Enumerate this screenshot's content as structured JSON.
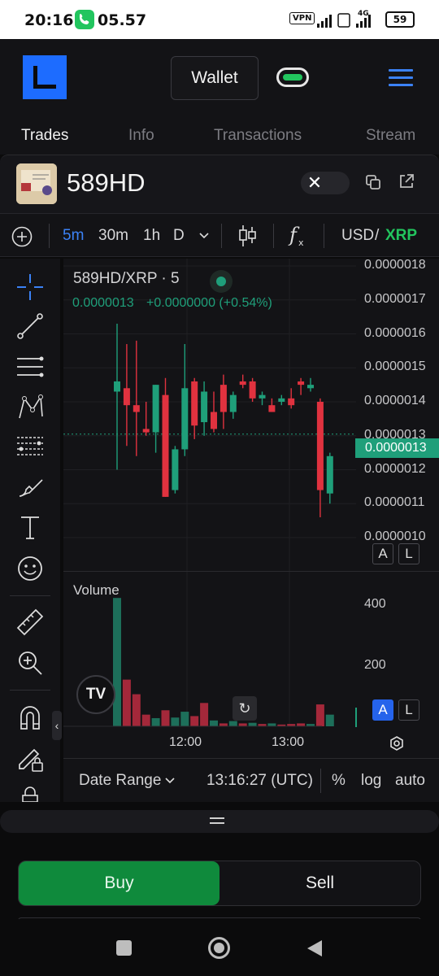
{
  "status_bar": {
    "time": "20:16",
    "call_time": "05.57",
    "vpn": "VPN",
    "network": "4G",
    "battery": "59"
  },
  "header": {
    "wallet_label": "Wallet"
  },
  "tabs": [
    {
      "label": "Trades",
      "active": true
    },
    {
      "label": "Info",
      "active": false
    },
    {
      "label": "Transactions",
      "active": false
    },
    {
      "label": "Stream",
      "active": false
    }
  ],
  "token": {
    "name": "589HD"
  },
  "toolbar": {
    "intervals": [
      "5m",
      "30m",
      "1h",
      "D"
    ],
    "selected_interval": "5m",
    "quote_usd": "USD",
    "quote_sep": "/",
    "quote_xrp": "XRP"
  },
  "chart": {
    "symbol": "589HD/XRP · 5",
    "last_price": "0.0000013",
    "change": "+0.0000000 (+0.54%)",
    "price_tag": "0.0000013",
    "price_ticks": [
      "0.0000018",
      "0.0000017",
      "0.0000016",
      "0.0000015",
      "0.0000014",
      "0.0000013",
      "0.0000012",
      "0.0000011",
      "0.0000010"
    ],
    "volume_label": "Volume",
    "volume_ticks": [
      "400",
      "200"
    ],
    "time_ticks": [
      "12:00",
      "13:00"
    ],
    "btn_a": "A",
    "btn_l": "L",
    "colors": {
      "up": "#1f9f7a",
      "down": "#e0323f",
      "accent": "#22c55e",
      "blue": "#3b82f6"
    }
  },
  "date_bar": {
    "date_range": "Date Range",
    "utc_time": "13:16:27 (UTC)",
    "percent": "%",
    "log": "log",
    "auto": "auto"
  },
  "trade": {
    "buy_label": "Buy",
    "sell_label": "Sell"
  },
  "chart_data": {
    "type": "candlestick",
    "ylim": [
      1e-06,
      1.8e-06
    ],
    "candles": [
      {
        "o": 1.43e-06,
        "h": 1.63e-06,
        "l": 1.2e-06,
        "c": 1.46e-06,
        "up": true
      },
      {
        "o": 1.44e-06,
        "h": 1.57e-06,
        "l": 1.27e-06,
        "c": 1.39e-06,
        "up": false
      },
      {
        "o": 1.39e-06,
        "h": 1.58e-06,
        "l": 1.24e-06,
        "c": 1.37e-06,
        "up": false
      },
      {
        "o": 1.32e-06,
        "h": 1.4e-06,
        "l": 1.3e-06,
        "c": 1.31e-06,
        "up": false
      },
      {
        "o": 1.31e-06,
        "h": 1.45e-06,
        "l": 1.25e-06,
        "c": 1.45e-06,
        "up": true
      },
      {
        "o": 1.42e-06,
        "h": 1.47e-06,
        "l": 1.12e-06,
        "c": 1.12e-06,
        "up": false
      },
      {
        "o": 1.14e-06,
        "h": 1.27e-06,
        "l": 1.13e-06,
        "c": 1.26e-06,
        "up": true
      },
      {
        "o": 1.26e-06,
        "h": 1.57e-06,
        "l": 1.24e-06,
        "c": 1.44e-06,
        "up": true
      },
      {
        "o": 1.46e-06,
        "h": 1.47e-06,
        "l": 1.29e-06,
        "c": 1.33e-06,
        "up": false
      },
      {
        "o": 1.34e-06,
        "h": 1.46e-06,
        "l": 1.3e-06,
        "c": 1.43e-06,
        "up": true
      },
      {
        "o": 1.37e-06,
        "h": 1.43e-06,
        "l": 1.31e-06,
        "c": 1.32e-06,
        "up": false
      },
      {
        "o": 1.45e-06,
        "h": 1.48e-06,
        "l": 1.32e-06,
        "c": 1.37e-06,
        "up": false
      },
      {
        "o": 1.37e-06,
        "h": 1.43e-06,
        "l": 1.35e-06,
        "c": 1.42e-06,
        "up": true
      },
      {
        "o": 1.46e-06,
        "h": 1.48e-06,
        "l": 1.44e-06,
        "c": 1.45e-06,
        "up": false
      },
      {
        "o": 1.46e-06,
        "h": 1.47e-06,
        "l": 1.4e-06,
        "c": 1.41e-06,
        "up": false
      },
      {
        "o": 1.41e-06,
        "h": 1.43e-06,
        "l": 1.39e-06,
        "c": 1.42e-06,
        "up": true
      },
      {
        "o": 1.39e-06,
        "h": 1.41e-06,
        "l": 1.37e-06,
        "c": 1.37e-06,
        "up": false
      },
      {
        "o": 1.4e-06,
        "h": 1.42e-06,
        "l": 1.39e-06,
        "c": 1.41e-06,
        "up": true
      },
      {
        "o": 1.41e-06,
        "h": 1.44e-06,
        "l": 1.38e-06,
        "c": 1.39e-06,
        "up": false
      },
      {
        "o": 1.46e-06,
        "h": 1.47e-06,
        "l": 1.42e-06,
        "c": 1.45e-06,
        "up": false
      },
      {
        "o": 1.45e-06,
        "h": 1.47e-06,
        "l": 1.43e-06,
        "c": 1.44e-06,
        "up": true
      },
      {
        "o": 1.4e-06,
        "h": 1.41e-06,
        "l": 1.06e-06,
        "c": 1.14e-06,
        "up": false
      },
      {
        "o": 1.13e-06,
        "h": 1.25e-06,
        "l": 1.1e-06,
        "c": 1.24e-06,
        "up": true
      }
    ],
    "volume_ylim": [
      0,
      460
    ],
    "volumes": [
      {
        "v": 440,
        "up": true
      },
      {
        "v": 160,
        "up": false
      },
      {
        "v": 110,
        "up": false
      },
      {
        "v": 40,
        "up": false
      },
      {
        "v": 28,
        "up": true
      },
      {
        "v": 55,
        "up": false
      },
      {
        "v": 30,
        "up": true
      },
      {
        "v": 50,
        "up": true
      },
      {
        "v": 35,
        "up": false
      },
      {
        "v": 80,
        "up": false
      },
      {
        "v": 20,
        "up": true
      },
      {
        "v": 10,
        "up": false
      },
      {
        "v": 18,
        "up": true
      },
      {
        "v": 10,
        "up": false
      },
      {
        "v": 12,
        "up": true
      },
      {
        "v": 8,
        "up": false
      },
      {
        "v": 10,
        "up": true
      },
      {
        "v": 6,
        "up": false
      },
      {
        "v": 8,
        "up": false
      },
      {
        "v": 10,
        "up": false
      },
      {
        "v": 8,
        "up": true
      },
      {
        "v": 75,
        "up": false
      },
      {
        "v": 40,
        "up": true
      }
    ]
  }
}
